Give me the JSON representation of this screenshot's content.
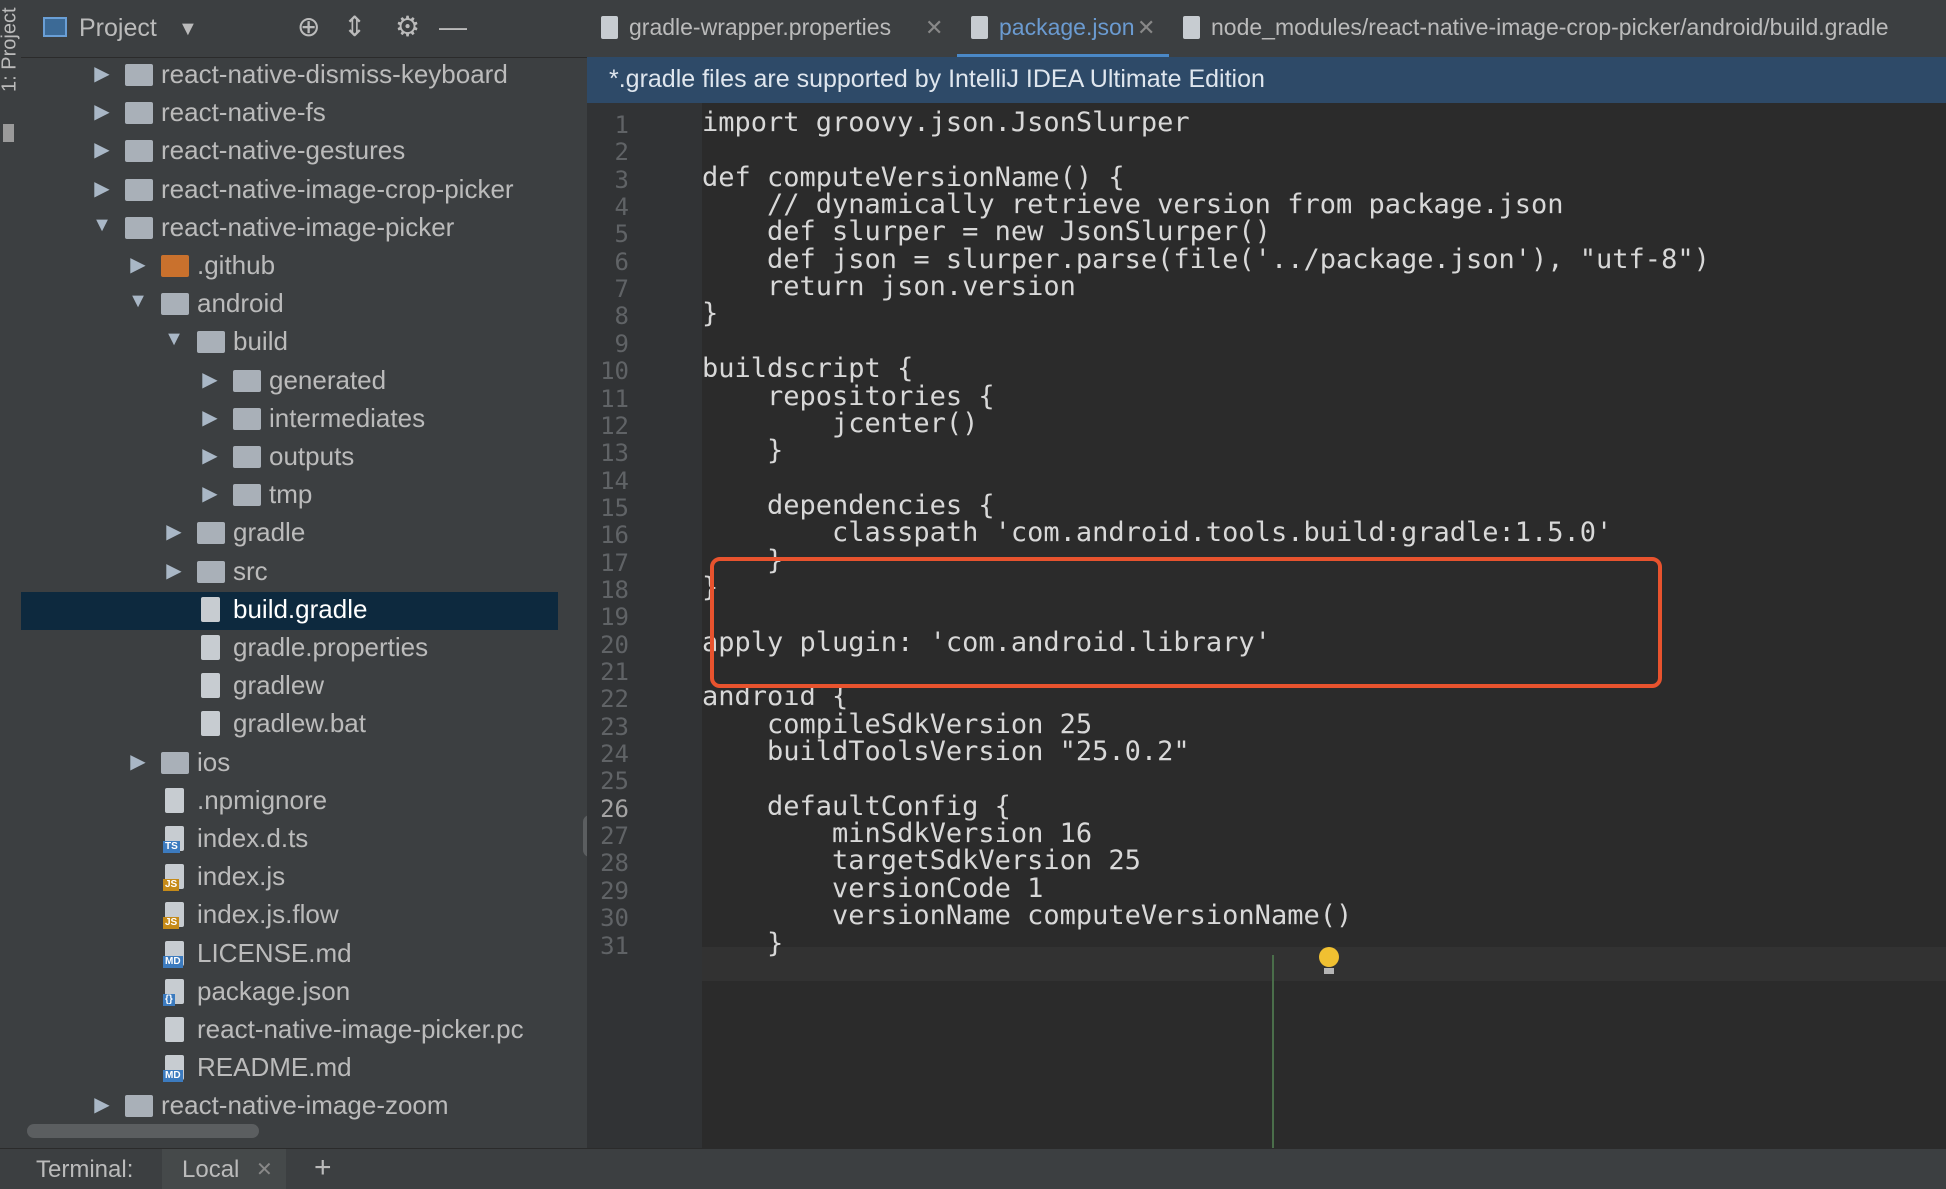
{
  "toolstrip": {
    "label": "1: Project"
  },
  "project": {
    "title": "Project",
    "tree": [
      {
        "label": "react-native-dismiss-keyboard",
        "depth": 0,
        "type": "folder",
        "expanded": false
      },
      {
        "label": "react-native-fs",
        "depth": 0,
        "type": "folder",
        "expanded": false
      },
      {
        "label": "react-native-gestures",
        "depth": 0,
        "type": "folder",
        "expanded": false
      },
      {
        "label": "react-native-image-crop-picker",
        "depth": 0,
        "type": "folder",
        "expanded": false
      },
      {
        "label": "react-native-image-picker",
        "depth": 0,
        "type": "folder",
        "expanded": true
      },
      {
        "label": ".github",
        "depth": 1,
        "type": "folder-orange",
        "expanded": false
      },
      {
        "label": "android",
        "depth": 1,
        "type": "folder",
        "expanded": true
      },
      {
        "label": "build",
        "depth": 2,
        "type": "folder",
        "expanded": true
      },
      {
        "label": "generated",
        "depth": 3,
        "type": "folder",
        "expanded": false
      },
      {
        "label": "intermediates",
        "depth": 3,
        "type": "folder",
        "expanded": false
      },
      {
        "label": "outputs",
        "depth": 3,
        "type": "folder",
        "expanded": false
      },
      {
        "label": "tmp",
        "depth": 3,
        "type": "folder",
        "expanded": false
      },
      {
        "label": "gradle",
        "depth": 2,
        "type": "folder",
        "expanded": false
      },
      {
        "label": "src",
        "depth": 2,
        "type": "folder",
        "expanded": false
      },
      {
        "label": "build.gradle",
        "depth": 2,
        "type": "file",
        "selected": true
      },
      {
        "label": "gradle.properties",
        "depth": 2,
        "type": "file"
      },
      {
        "label": "gradlew",
        "depth": 2,
        "type": "file"
      },
      {
        "label": "gradlew.bat",
        "depth": 2,
        "type": "file"
      },
      {
        "label": "ios",
        "depth": 1,
        "type": "folder",
        "expanded": false
      },
      {
        "label": ".npmignore",
        "depth": 1,
        "type": "file"
      },
      {
        "label": "index.d.ts",
        "depth": 1,
        "type": "file",
        "badge": "TS"
      },
      {
        "label": "index.js",
        "depth": 1,
        "type": "file",
        "badge": "JS"
      },
      {
        "label": "index.js.flow",
        "depth": 1,
        "type": "file",
        "badge": "JS"
      },
      {
        "label": "LICENSE.md",
        "depth": 1,
        "type": "file",
        "badge": "MD"
      },
      {
        "label": "package.json",
        "depth": 1,
        "type": "file",
        "badge": "{}"
      },
      {
        "label": "react-native-image-picker.pc",
        "depth": 1,
        "type": "file"
      },
      {
        "label": "README.md",
        "depth": 1,
        "type": "file",
        "badge": "MD"
      },
      {
        "label": "react-native-image-zoom",
        "depth": 0,
        "type": "folder",
        "expanded": false
      }
    ]
  },
  "tabs": [
    {
      "label": "gradle-wrapper.properties",
      "active": false
    },
    {
      "label": "package.json",
      "active": true
    },
    {
      "label": "node_modules/react-native-image-crop-picker/android/build.gradle",
      "active": false
    }
  ],
  "banner": "*.gradle files are supported by IntelliJ IDEA Ultimate Edition",
  "editor": {
    "current_line": 26,
    "lines": [
      "import groovy.json.JsonSlurper",
      "",
      "def computeVersionName() {",
      "    // dynamically retrieve version from package.json",
      "    def slurper = new JsonSlurper()",
      "    def json = slurper.parse(file('../package.json'), \"utf-8\")",
      "    return json.version",
      "}",
      "",
      "buildscript {",
      "    repositories {",
      "        jcenter()",
      "    }",
      "",
      "    dependencies {",
      "        classpath 'com.android.tools.build:gradle:1.5.0'",
      "    }",
      "}",
      "",
      "apply plugin: 'com.android.library'",
      "",
      "android {",
      "    compileSdkVersion 25",
      "    buildToolsVersion \"25.0.2\"",
      "",
      "    defaultConfig {",
      "        minSdkVersion 16",
      "        targetSdkVersion 25",
      "        versionCode 1",
      "        versionName computeVersionName()",
      "    }"
    ]
  },
  "bottom": {
    "label": "Terminal:",
    "tab": "Local",
    "plus": "+"
  },
  "colors": {
    "highlight_box": "#e8532e",
    "banner_bg": "#2e4a68",
    "selection": "#0d293e"
  }
}
